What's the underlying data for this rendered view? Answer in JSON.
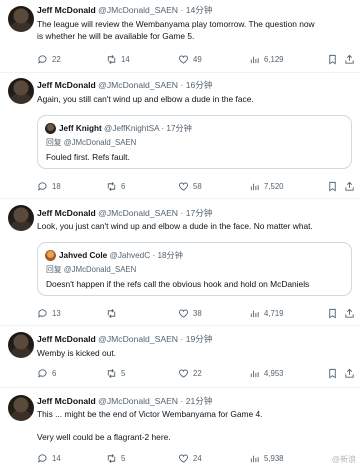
{
  "tweets": [
    {
      "author": {
        "name": "Jeff McDonald",
        "handle": "@JMcDonald_SAEN",
        "time": "14分钟"
      },
      "text": "The league will review the Wembanyama play tomorrow. The question now\nis whether he will be available for Game 5.",
      "stats": {
        "replies": "22",
        "reposts": "14",
        "likes": "49",
        "views": "6,129"
      }
    },
    {
      "author": {
        "name": "Jeff McDonald",
        "handle": "@JMcDonald_SAEN",
        "time": "16分钟"
      },
      "text": "Again, you still can't wind up and elbow a dude in the face.",
      "quote": {
        "name": "Jeff Knight",
        "handle": "@JeffKnightSA",
        "time": "17分钟",
        "reply_prefix": "回复",
        "reply_to": "@JMcDonald_SAEN",
        "text": "Fouled first.  Refs fault."
      },
      "stats": {
        "replies": "18",
        "reposts": "6",
        "likes": "58",
        "views": "7,520"
      }
    },
    {
      "author": {
        "name": "Jeff McDonald",
        "handle": "@JMcDonald_SAEN",
        "time": "17分钟"
      },
      "text": "Look, you just can't wind up and elbow a dude in the face. No matter what.",
      "quote": {
        "name": "Jahved Cole",
        "handle": "@JahvedC",
        "time": "18分钟",
        "reply_prefix": "回复",
        "reply_to": "@JMcDonald_SAEN",
        "text": "Doesn't happen if the refs call the obvious hook and hold on McDaniels"
      },
      "stats": {
        "replies": "13",
        "reposts": "",
        "likes": "38",
        "views": "4,719"
      }
    },
    {
      "author": {
        "name": "Jeff McDonald",
        "handle": "@JMcDonald_SAEN",
        "time": "19分钟"
      },
      "text": "Wemby is kicked out.",
      "stats": {
        "replies": "6",
        "reposts": "5",
        "likes": "22",
        "views": "4,953"
      }
    },
    {
      "author": {
        "name": "Jeff McDonald",
        "handle": "@JMcDonald_SAEN",
        "time": "21分钟"
      },
      "text": "This ... might be the end of Victor Wembanyama for Game 4.\n\nVery well could be a flagrant-2 here.",
      "stats": {
        "replies": "14",
        "reposts": "5",
        "likes": "24",
        "views": "5,938"
      }
    }
  ],
  "separator": "·",
  "watermark": "@新浪"
}
